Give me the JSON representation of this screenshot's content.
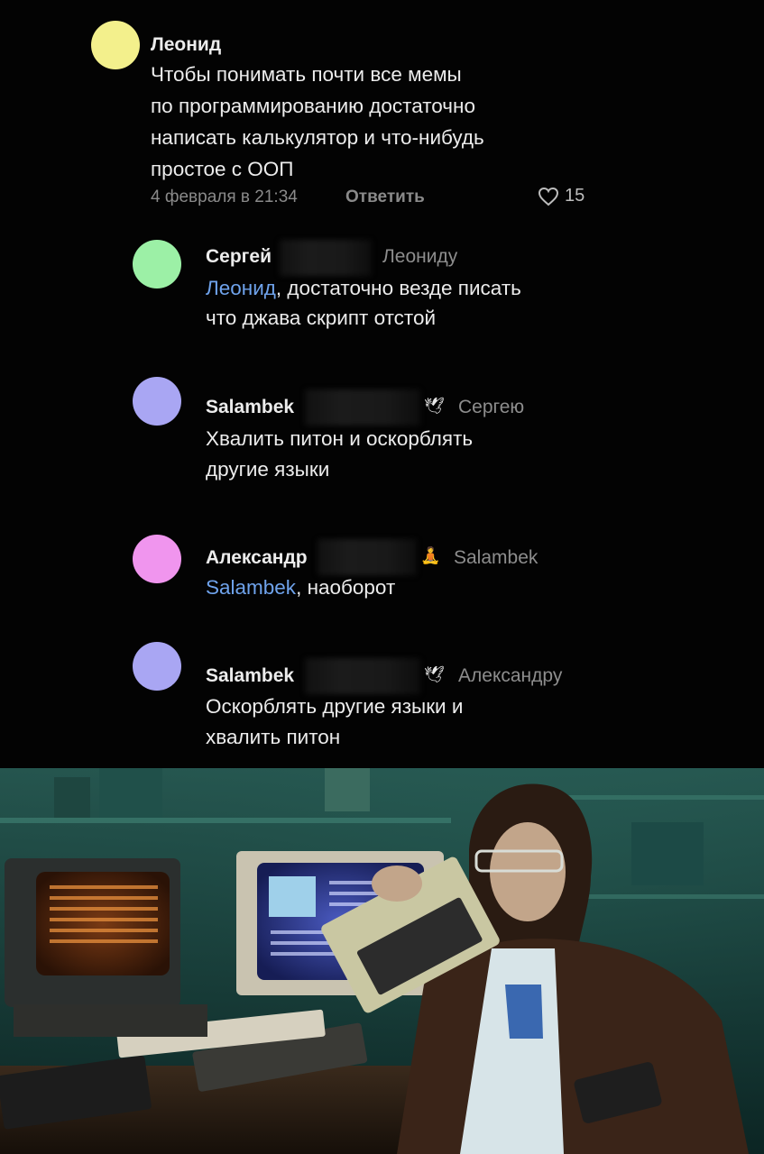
{
  "comments": [
    {
      "author": "Леонид",
      "text_lines": [
        "Чтобы понимать почти все мемы",
        "по программированию достаточно",
        "написать калькулятор и что-нибудь",
        "простое с ООП"
      ],
      "date": "4 февраля в 21:34",
      "reply_label": "Ответить",
      "likes": "15",
      "avatar_color": "#f3f08c"
    },
    {
      "author": "Сергей",
      "reply_to": "Леониду",
      "mention": "Леонид",
      "text_after_mention": ", достаточно везде писать",
      "text_line2": "что джава скрипт отстой",
      "avatar_color": "#9cf0a6"
    },
    {
      "author": "Salambek",
      "badge": "🕊",
      "reply_to": "Сергею",
      "text_lines": [
        "Хвалить питон и оскорблять",
        "другие языки"
      ],
      "avatar_color": "#a9a6f3"
    },
    {
      "author": "Александр",
      "badge": "🧘",
      "reply_to": "Salambek",
      "mention": "Salambek",
      "text_after_mention": ", наоборот",
      "avatar_color": "#f095ee"
    },
    {
      "author": "Salambek",
      "badge": "🕊",
      "reply_to": "Александру",
      "text_lines": [
        "Оскорблять другие языки и",
        "хвалить питон"
      ],
      "avatar_color": "#a9a6f3"
    }
  ],
  "icons": {
    "like": "heart-outline-icon"
  },
  "photo": {
    "description_icon": "retro-computers-photo"
  }
}
